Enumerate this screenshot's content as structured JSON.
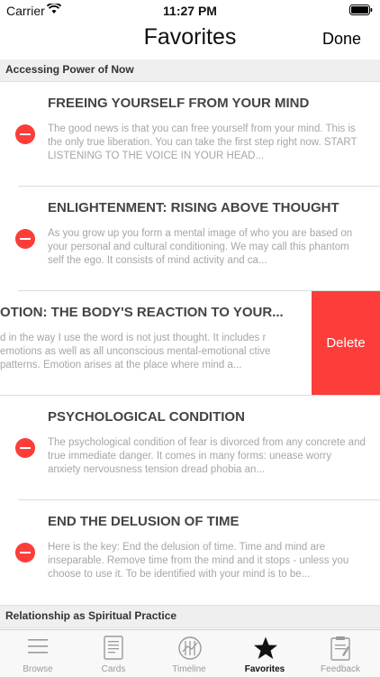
{
  "status": {
    "carrier": "Carrier",
    "time": "11:27 PM"
  },
  "nav": {
    "title": "Favorites",
    "done_label": "Done"
  },
  "sections": [
    {
      "header": "Accessing Power of Now"
    },
    {
      "header": "Relationship as Spiritual Practice"
    }
  ],
  "rows": [
    {
      "title": "FREEING YOURSELF FROM YOUR MIND",
      "body": "The good news is that you can free yourself from your mind. This is the only true liberation. You can take the first step right now.  START LISTENING TO THE VOICE IN YOUR HEAD..."
    },
    {
      "title": "ENLIGHTENMENT: RISING ABOVE THOUGHT",
      "body": "As you grow up you form a mental image of who you are based on your personal and cultural conditioning. We may call this phantom self the ego. It consists of mind activity and ca..."
    },
    {
      "title": "OTION: THE BODY'S REACTION TO YOUR...",
      "body": "d in the way I use the word is not just thought. It includes r emotions as well as all unconscious mental-emotional ctive patterns. Emotion arises at the place where mind a..."
    },
    {
      "title": "PSYCHOLOGICAL CONDITION",
      "body": "The psychological condition of fear is divorced from any concrete and true immediate danger. It comes in many forms: unease worry anxiety nervousness tension dread phobia an..."
    },
    {
      "title": "END THE DELUSION OF TIME",
      "body": "Here is the key: End the delusion of time. Time and mind are inseparable. Remove time from the mind and it stops - unless you choose to use it. To be identified with your mind is to be..."
    }
  ],
  "delete_label": "Delete",
  "tabs": [
    {
      "label": "Browse",
      "icon": "hamburger-icon"
    },
    {
      "label": "Cards",
      "icon": "card-icon"
    },
    {
      "label": "Timeline",
      "icon": "timeline-icon"
    },
    {
      "label": "Favorites",
      "icon": "star-icon",
      "active": true
    },
    {
      "label": "Feedback",
      "icon": "clipboard-icon"
    }
  ],
  "colors": {
    "delete": "#fc3d39",
    "tab_active": "#111111",
    "tab_inactive": "#9a9a9a"
  }
}
